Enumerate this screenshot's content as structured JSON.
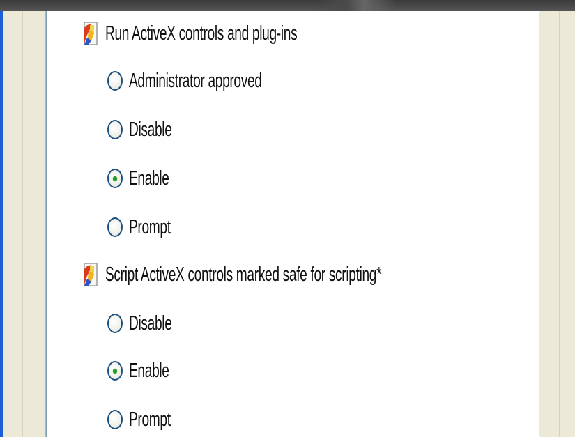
{
  "colors": {
    "window_bg": "#ece9d8",
    "list_bg": "#ffffff",
    "radio_border": "#1c5180",
    "radio_selected_dot": "#21a121",
    "scroll_button": "#c8d7fb",
    "left_edge": "#1f5fd6"
  },
  "settings": [
    {
      "label": "Run ActiveX controls and plug-ins",
      "icon": "settings-page-icon",
      "options": [
        {
          "label": "Administrator approved",
          "selected": false
        },
        {
          "label": "Disable",
          "selected": false
        },
        {
          "label": "Enable",
          "selected": true
        },
        {
          "label": "Prompt",
          "selected": false
        }
      ]
    },
    {
      "label": "Script ActiveX controls marked safe for scripting*",
      "icon": "settings-page-icon",
      "options": [
        {
          "label": "Disable",
          "selected": false
        },
        {
          "label": "Enable",
          "selected": true
        },
        {
          "label": "Prompt",
          "selected": false
        }
      ]
    }
  ],
  "scrollbar": {
    "up_icon": "arrow-up-icon"
  }
}
